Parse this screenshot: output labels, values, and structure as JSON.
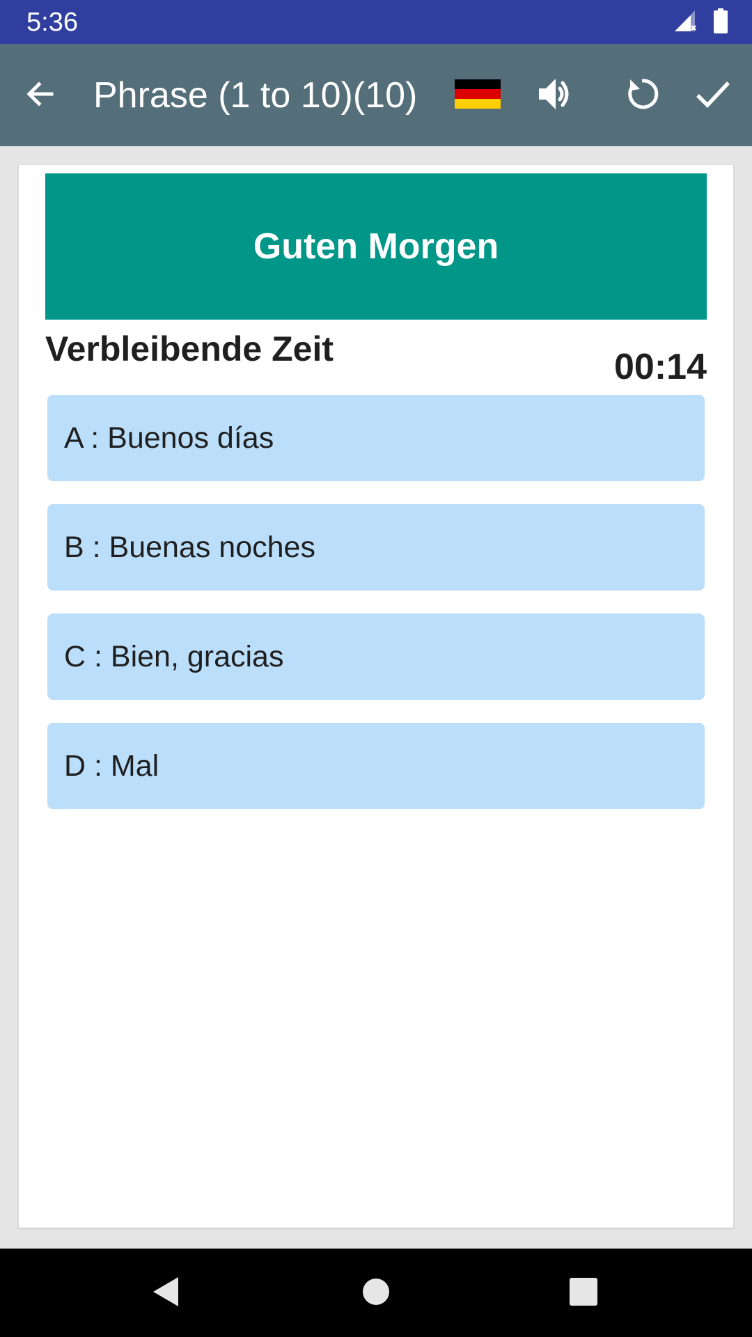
{
  "status_bar": {
    "time": "5:36",
    "icons": [
      "signal-icon",
      "battery-icon"
    ]
  },
  "app_bar": {
    "back_icon": "arrow-back-icon",
    "title": "Phrase (1 to 10)(10)",
    "flag_icon": "german-flag-icon",
    "speaker_icon": "volume-icon",
    "refresh_icon": "refresh-icon",
    "check_icon": "check-icon",
    "colors": {
      "background": "#546e7a",
      "status_background": "#303f9f"
    }
  },
  "quiz": {
    "word": "Guten Morgen",
    "remaining_label": "Verbleibende Zeit",
    "timer": "00:14",
    "options": [
      {
        "label": "A : Buenos días"
      },
      {
        "label": "B : Buenas noches"
      },
      {
        "label": "C : Bien, gracias"
      },
      {
        "label": "D : Mal"
      }
    ],
    "colors": {
      "banner": "#009688",
      "option": "#bbdefb"
    }
  },
  "nav_bar": {
    "icons": [
      "nav-back-icon",
      "nav-home-icon",
      "nav-recents-icon"
    ]
  }
}
